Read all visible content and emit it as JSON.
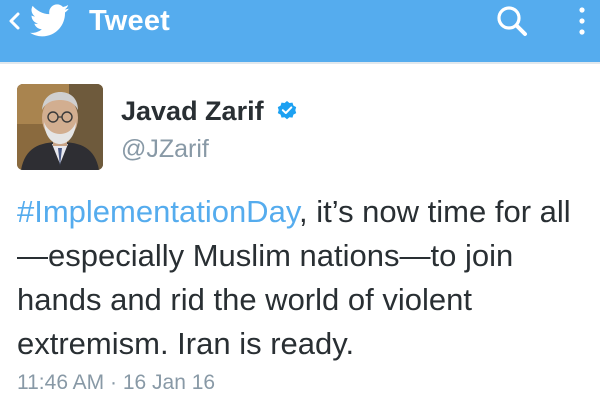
{
  "colors": {
    "header_bg": "#55acee",
    "link": "#55acee",
    "text": "#292f33",
    "muted": "#8899a6",
    "verified": "#1da1f2"
  },
  "header": {
    "back_icon": "chevron-left-icon",
    "logo_icon": "twitter-bird-icon",
    "title": "Tweet",
    "search_icon": "search-icon",
    "menu_icon": "overflow-menu-icon"
  },
  "tweet": {
    "author": {
      "name": "Javad Zarif",
      "handle": "@JZarif",
      "verified": true
    },
    "text": {
      "hashtag": "#ImplementationDay",
      "line1_rest": ", it’s now time for all",
      "line2": "—especially Muslim nations—to join",
      "line3": "hands and rid the world of violent",
      "line4": "extremism. Iran is ready."
    },
    "timestamp": "11:46 AM · 16 Jan 16"
  }
}
